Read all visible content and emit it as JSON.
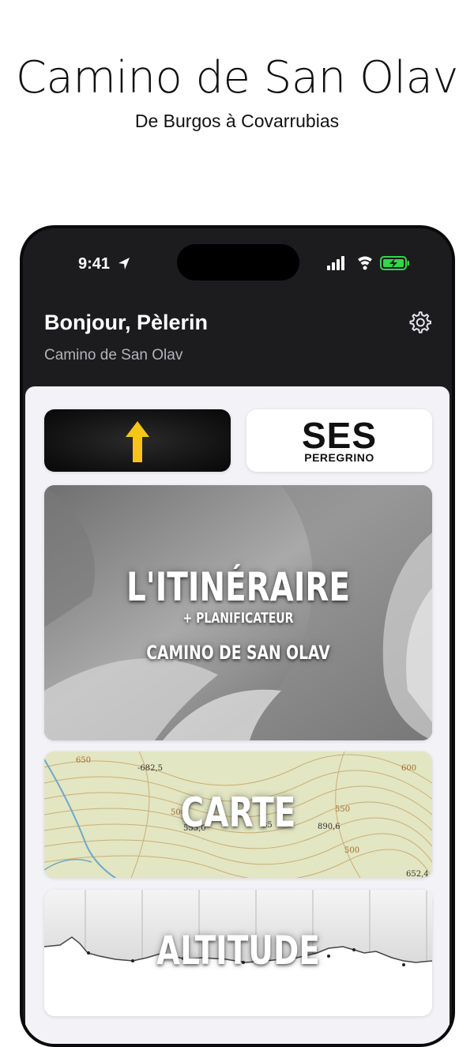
{
  "promo": {
    "title": "Camino de San Olav",
    "subtitle": "De Burgos à Covarrubias"
  },
  "status_bar": {
    "time": "9:41",
    "icons": [
      "location-arrow-icon",
      "cellular-signal-icon",
      "wifi-icon",
      "battery-charging-icon"
    ]
  },
  "header": {
    "greeting": "Bonjour, Pèlerin",
    "subtitle": "Camino de San Olav",
    "settings_icon": "gear-icon"
  },
  "tiles": {
    "arrow": {
      "icon": "yellow-arrow-up-icon",
      "color": "#f5c518"
    },
    "ses": {
      "title": "SES",
      "subtitle": "PEREGRINO"
    },
    "route": {
      "title": "L'ITINÉRAIRE",
      "planner": "+ PLANIFICATEUR",
      "subtitle": "CAMINO DE SAN OLAV"
    },
    "map": {
      "title": "CARTE",
      "contour_labels": [
        "-682,5",
        "650",
        "600",
        "550",
        "500",
        "890,6",
        "35",
        "553,0",
        "500",
        "652,4"
      ]
    },
    "altitude": {
      "title": "ALTITUDE"
    }
  },
  "colors": {
    "phone_bg": "#1c1c1e",
    "content_bg": "#f2f2f7",
    "accent_yellow": "#f5c518",
    "battery_green": "#32d74b"
  }
}
